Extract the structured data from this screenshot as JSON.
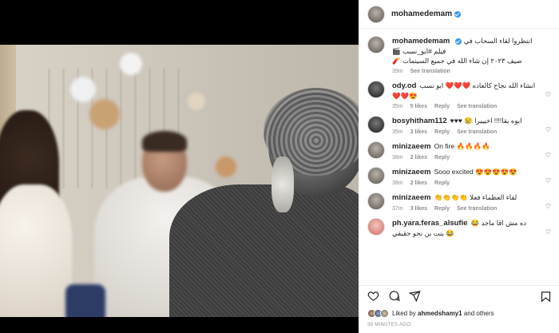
{
  "post": {
    "author": "mohamedemam",
    "verified": true,
    "caption_line1": "انتظروا لقاء السحاب في",
    "caption_line2": "فيلم #ابو_نسب 🎬",
    "caption_line3": "صيف ٢٠٢٣ إن شاء الله في جميع السينمات 🧨",
    "caption_time": "39m",
    "caption_translate": "See translation"
  },
  "comments": [
    {
      "user": "ody.od",
      "text": "انشاء الله نجاح كالعاده ❤️❤️❤️ ابو نسب",
      "text2": "❤️❤️😍",
      "time": "35m",
      "likes": "5 likes",
      "reply": "Reply",
      "translate": "See translation",
      "avatar": "dark"
    },
    {
      "user": "bosyhitham112",
      "text": "ابوه بقا!!!! اخيييرا 😢 ♥♥♥",
      "time": "35m",
      "likes": "3 likes",
      "reply": "Reply",
      "translate": "See translation",
      "avatar": "dark"
    },
    {
      "user": "minizaeem",
      "text": "On fire 🔥🔥🔥🔥",
      "time": "38m",
      "likes": "2 likes",
      "reply": "Reply",
      "avatar": "gray"
    },
    {
      "user": "minizaeem",
      "text": "Sooo excited 😍😍😍😍😍",
      "time": "38m",
      "likes": "2 likes",
      "reply": "Reply",
      "avatar": "gray"
    },
    {
      "user": "minizaeem",
      "text": "لقاء العظماء فعلا 👏👏👏👏",
      "time": "37m",
      "likes": "3 likes",
      "reply": "Reply",
      "translate": "See translation",
      "avatar": "gray"
    },
    {
      "user": "ph.yara.feras_alsufie",
      "text": "ده مش اقا ماجد 😂",
      "text2": "😂 بنت بن نحو حقيقي",
      "time": "",
      "likes": "",
      "reply": "",
      "avatar": "pink"
    }
  ],
  "liked_by": {
    "prefix": "Liked by",
    "user": "ahmedshamy1",
    "suffix": "and others"
  },
  "timestamp": "39 MINUTES AGO",
  "icons": [
    "heart-icon",
    "comment-icon",
    "share-icon",
    "bookmark-icon",
    "verified-icon",
    "like-comment-icon"
  ]
}
